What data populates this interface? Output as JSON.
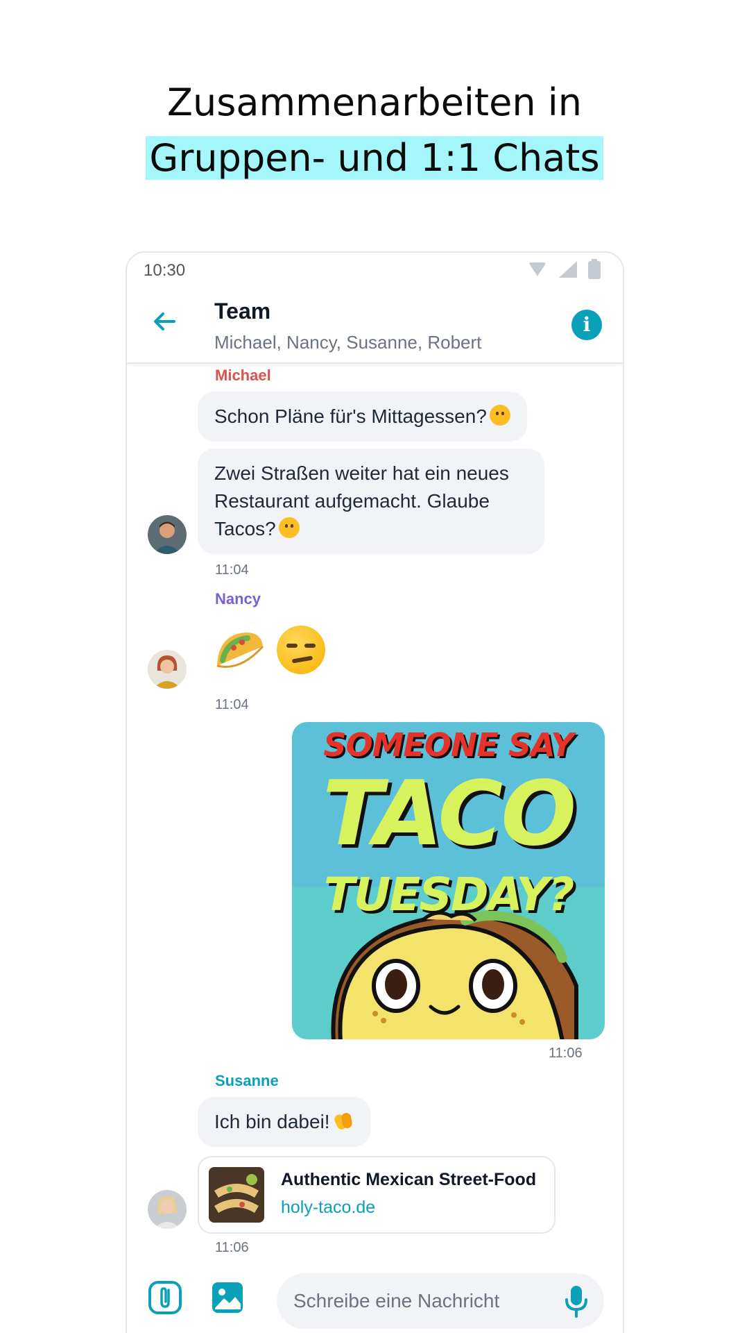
{
  "headline": {
    "line1": "Zusammenarbeiten in",
    "line2": "Gruppen- und 1:1 Chats"
  },
  "status_bar": {
    "time": "10:30"
  },
  "chat_header": {
    "title": "Team",
    "members": "Michael, Nancy, Susanne, Robert"
  },
  "messages": {
    "michael": {
      "sender": "Michael",
      "text1": "Schon Pläne für's Mittagessen?",
      "text2": "Zwei Straßen weiter hat ein neues Restaurant aufgemacht. Glaube Tacos?",
      "time": "11:04"
    },
    "nancy": {
      "sender": "Nancy",
      "time": "11:04"
    },
    "own_gif": {
      "line1": "SOMEONE SAY",
      "line2": "TACO",
      "line3": "TUESDAY?",
      "time": "11:06"
    },
    "susanne": {
      "sender": "Susanne",
      "text": "Ich bin dabei!",
      "link_title": "Authentic Mexican Street-Food",
      "link_url": "holy-taco.de",
      "time": "11:06"
    }
  },
  "composer": {
    "placeholder": "Schreibe eine Nachricht"
  },
  "colors": {
    "accent": "#0aa0b8",
    "highlight": "#a4f6fb",
    "michael": "#d9534f",
    "nancy": "#7b5fd6",
    "susanne": "#0aa0b8",
    "bubble": "#f1f3f6"
  },
  "icons": [
    "back-arrow-icon",
    "info-icon",
    "wifi-icon",
    "signal-icon",
    "battery-icon",
    "paperclip-icon",
    "image-icon",
    "microphone-icon"
  ]
}
